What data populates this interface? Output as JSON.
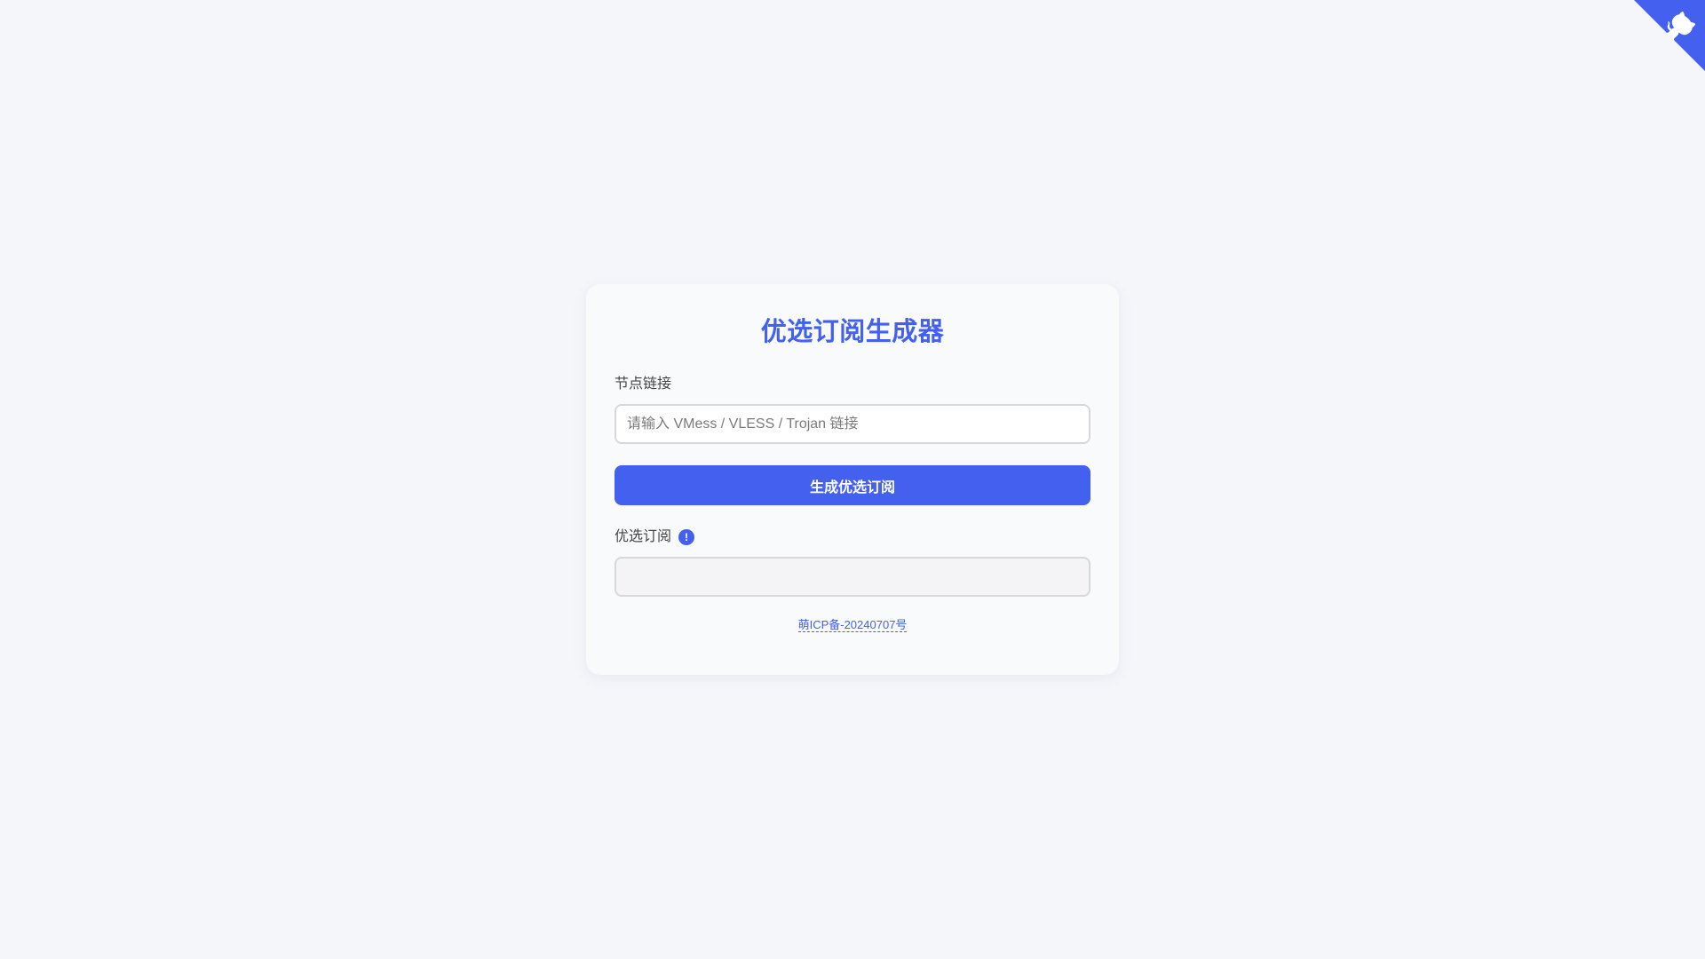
{
  "github_corner": {
    "icon": "github-octocat-icon",
    "color": "#4361ee"
  },
  "card": {
    "title": "优选订阅生成器",
    "node_link": {
      "label": "节点链接",
      "placeholder": "请输入 VMess / VLESS / Trojan 链接",
      "value": ""
    },
    "generate_button": "生成优选订阅",
    "subscription": {
      "label": "优选订阅",
      "info_icon": "!",
      "value": ""
    },
    "footer_link": "萌ICP备-20240707号"
  },
  "colors": {
    "accent": "#4361ee",
    "background": "#f5f6fa",
    "card": "#f9fafc"
  }
}
